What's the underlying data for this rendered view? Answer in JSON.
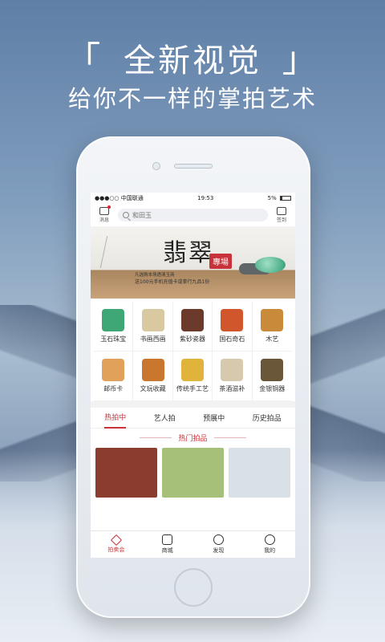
{
  "headline": {
    "open": "「",
    "text": "全新视觉",
    "close": "」"
  },
  "subline": "给你不一样的掌拍艺术",
  "status": {
    "carrier": "●●●○○ 中国联通",
    "time": "19:53",
    "battery": "5%"
  },
  "topbar": {
    "message_label": "消息",
    "search_placeholder": "和田玉",
    "checkin_label": "签到"
  },
  "banner": {
    "title": "翡翠",
    "seal": "專場",
    "line1": "凡选购本场透清玉商",
    "line2": "送100元手机充值卡或拳行九品1份"
  },
  "categories": [
    {
      "name": "玉石珠宝",
      "color": "#3fa676"
    },
    {
      "name": "书画西画",
      "color": "#d9c9a0"
    },
    {
      "name": "紫砂瓷器",
      "color": "#6b3a2a"
    },
    {
      "name": "国石奇石",
      "color": "#d1562b"
    },
    {
      "name": "木艺",
      "color": "#c98a3a"
    },
    {
      "name": "邮币卡",
      "color": "#e2a15a"
    },
    {
      "name": "文玩收藏",
      "color": "#c9772e"
    },
    {
      "name": "传统手工艺",
      "color": "#e0b43a"
    },
    {
      "name": "茶酒滋补",
      "color": "#d7c9ae"
    },
    {
      "name": "金银铜器",
      "color": "#6a5638"
    }
  ],
  "tabs": [
    {
      "label": "热拍中",
      "active": true
    },
    {
      "label": "艺人拍",
      "active": false
    },
    {
      "label": "预展中",
      "active": false
    },
    {
      "label": "历史拍品",
      "active": false
    }
  ],
  "section_title": "热门拍品",
  "products": [
    {
      "color": "#8a3d2e"
    },
    {
      "color": "#a6c07a"
    },
    {
      "color": "#d9e1e6"
    }
  ],
  "tabbar": [
    {
      "label": "拍卖会",
      "icon": "gavel-icon",
      "active": true
    },
    {
      "label": "商城",
      "icon": "bag-icon",
      "active": false
    },
    {
      "label": "发现",
      "icon": "compass-icon",
      "active": false
    },
    {
      "label": "我的",
      "icon": "person-icon",
      "active": false
    }
  ]
}
